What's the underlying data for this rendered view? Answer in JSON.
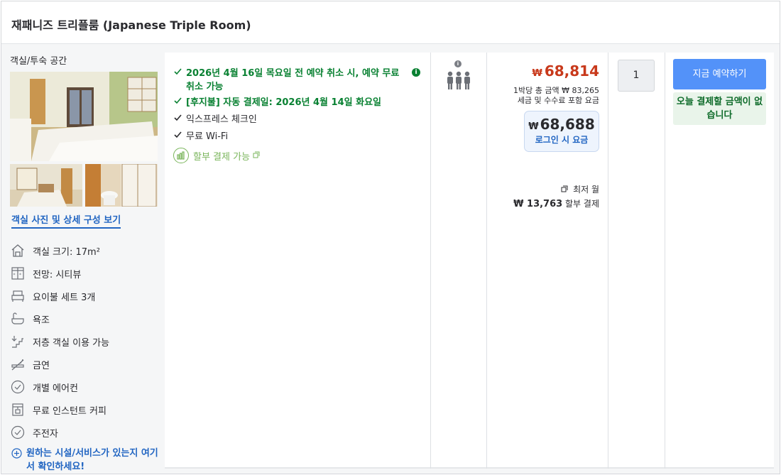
{
  "header": {
    "title": "재패니즈 트리플룸 (Japanese Triple Room)"
  },
  "left": {
    "room_type_label": "객실/투숙 공간",
    "photo_link": "객실 사진 및 상세 구성 보기",
    "features": [
      {
        "icon": "house-size-icon",
        "label": "객실 크기: 17m²"
      },
      {
        "icon": "window-view-icon",
        "label": "전망: 시티뷰"
      },
      {
        "icon": "bed-icon",
        "label": "요이불 세트 3개"
      },
      {
        "icon": "bathtub-icon",
        "label": "욕조"
      },
      {
        "icon": "stairs-down-icon",
        "label": "저층 객실 이용 가능"
      },
      {
        "icon": "no-smoking-icon",
        "label": "금연"
      },
      {
        "icon": "checkmark-circle-icon",
        "label": "개별 에어컨"
      },
      {
        "icon": "coffee-machine-icon",
        "label": "무료 인스턴트 커피"
      },
      {
        "icon": "checkmark-circle-icon",
        "label": "주전자"
      }
    ],
    "more_link": "원하는 시설/서비스가 있는지 여기서 확인하세요!"
  },
  "benefits": {
    "cancel": "2026년 4월 16일 목요일 전 예약 취소 시, 예약 무료 취소 가능",
    "auto_pay": "[후지불] 자동 결제일: 2026년 4월 14일 화요일",
    "express": "익스프레스 체크인",
    "wifi": "무료 Wi-Fi",
    "installment": "할부 결제 가능"
  },
  "price": {
    "currency": "₩",
    "original": "68,814",
    "per_night_line1": "1박당 총 금액 ₩ 83,265",
    "per_night_line2": "세금 및 수수료 포함 요금",
    "login_price": "68,688",
    "login_label": "로그인 시 요금",
    "monthly_label": "최저 월",
    "monthly_value": "₩ 13,763",
    "monthly_suffix": "할부 결제"
  },
  "booking": {
    "quantity": "1",
    "book_button": "지금 예약하기",
    "no_payment": "오늘 결제할 금액이 없습니다"
  },
  "colors": {
    "accent": "#5392f9",
    "green": "#098132",
    "red": "#c8391b",
    "link": "#2165c2"
  }
}
